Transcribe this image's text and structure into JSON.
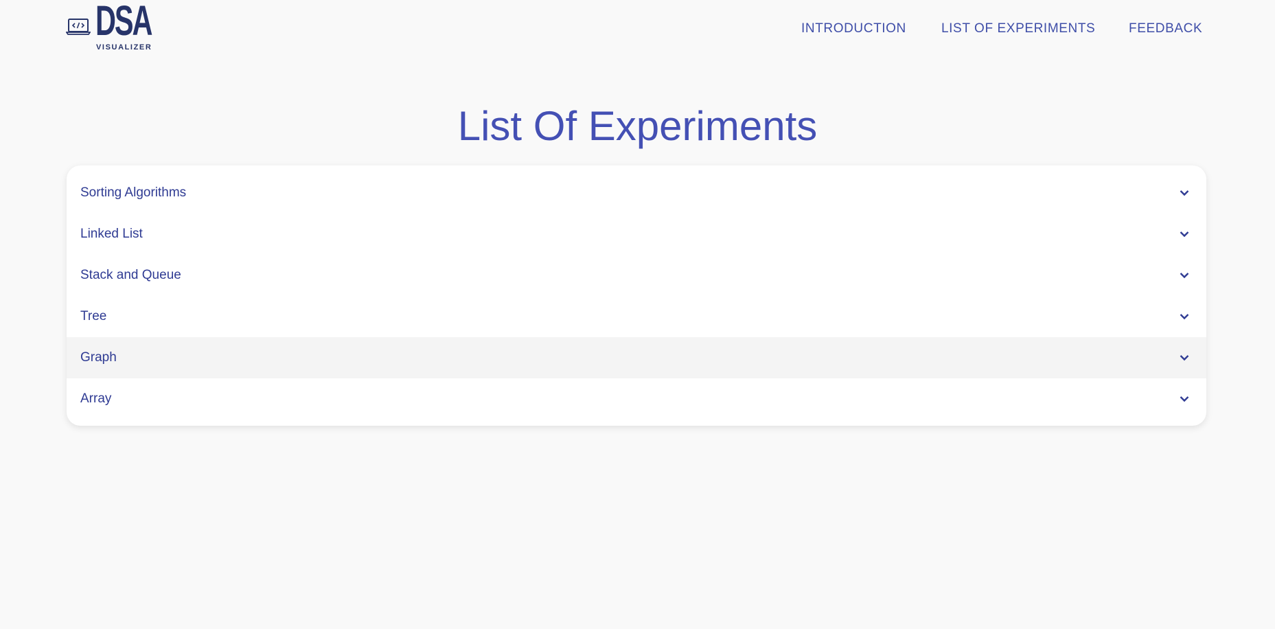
{
  "header": {
    "logo": {
      "title": "DSA",
      "subtitle": "VISUALIZER",
      "icon": "laptop-code-icon"
    },
    "nav": [
      {
        "label": "INTRODUCTION"
      },
      {
        "label": "LIST OF EXPERIMENTS"
      },
      {
        "label": "FEEDBACK"
      }
    ]
  },
  "main": {
    "title": "List Of Experiments",
    "accordion": [
      {
        "label": "Sorting Algorithms",
        "icon": "chevron-down-icon"
      },
      {
        "label": "Linked List",
        "icon": "chevron-down-icon"
      },
      {
        "label": "Stack and Queue",
        "icon": "chevron-down-icon"
      },
      {
        "label": "Tree",
        "icon": "chevron-down-icon"
      },
      {
        "label": "Graph",
        "icon": "chevron-down-icon",
        "hovered": true
      },
      {
        "label": "Array",
        "icon": "chevron-down-icon"
      }
    ]
  },
  "colors": {
    "background": "#f9f9f9",
    "brand_dark": "#273469",
    "accent": "#4450b4",
    "nav_text": "#3f4ea8",
    "item_text": "#2f3b93",
    "hover_row": "#f4f4f4"
  }
}
